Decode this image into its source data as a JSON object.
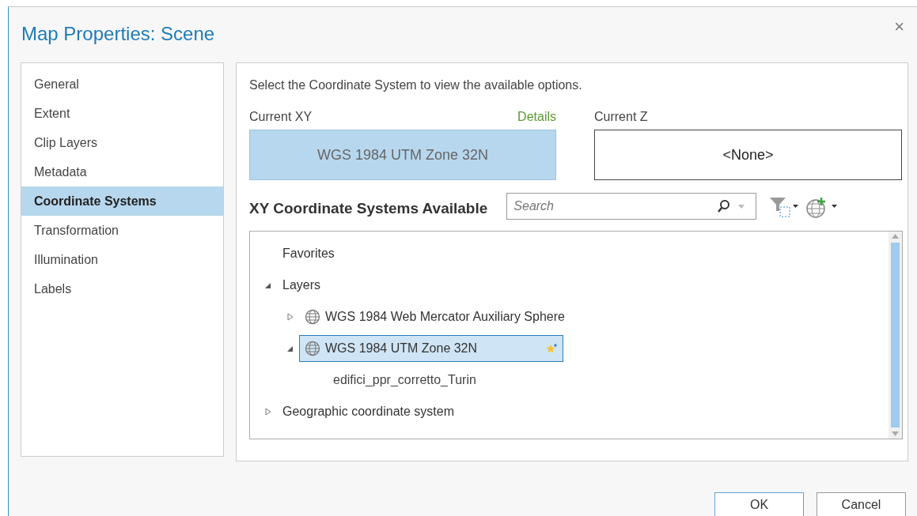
{
  "window": {
    "title": "Map Properties: Scene",
    "close": "×"
  },
  "sidebar": {
    "items": [
      {
        "label": "General",
        "selected": false
      },
      {
        "label": "Extent",
        "selected": false
      },
      {
        "label": "Clip Layers",
        "selected": false
      },
      {
        "label": "Metadata",
        "selected": false
      },
      {
        "label": "Coordinate Systems",
        "selected": true
      },
      {
        "label": "Transformation",
        "selected": false
      },
      {
        "label": "Illumination",
        "selected": false
      },
      {
        "label": "Labels",
        "selected": false
      }
    ]
  },
  "instructions": "Select the Coordinate System to view the available options.",
  "current_xy": {
    "label": "Current XY",
    "link": "Details",
    "value": "WGS 1984 UTM Zone 32N"
  },
  "current_z": {
    "label": "Current Z",
    "value": "<None>"
  },
  "available": {
    "heading": "XY Coordinate Systems Available",
    "search": {
      "placeholder": "Search"
    },
    "tree": [
      {
        "label": "Favorites",
        "kind": "folder",
        "selected": false
      },
      {
        "label": "Layers",
        "kind": "folder",
        "selected": false,
        "expanded": true,
        "children": [
          {
            "label": "WGS 1984 Web Mercator Auxiliary Sphere",
            "kind": "crs",
            "selected": false,
            "expanded": false
          },
          {
            "label": "WGS 1984 UTM Zone 32N",
            "kind": "crs",
            "selected": true,
            "expanded": true,
            "children": [
              {
                "label": "edifici_ppr_corretto_Turin",
                "kind": "layer",
                "selected": false
              }
            ]
          }
        ]
      },
      {
        "label": "Geographic coordinate system",
        "kind": "folder",
        "selected": false,
        "expanded": false
      }
    ]
  },
  "buttons": [
    "OK",
    "Cancel"
  ]
}
